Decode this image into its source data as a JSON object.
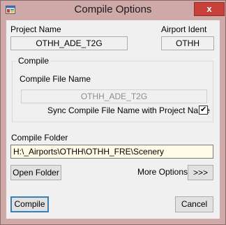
{
  "window": {
    "title": "Compile Options",
    "close_label": "x"
  },
  "project": {
    "name_label": "Project Name",
    "name_value": "OTHH_ADE_T2G",
    "ident_label": "Airport Ident",
    "ident_value": "OTHH"
  },
  "compile_group": {
    "title": "Compile",
    "file_name_label": "Compile File Name",
    "file_name_value": "OTHH_ADE_T2G",
    "sync_label": "Sync Compile File Name with Project Name",
    "sync_checked": true,
    "checkmark": "✔"
  },
  "folder": {
    "label": "Compile Folder",
    "value": "H:\\_Airports\\OTHH\\OTHH_FRE\\Scenery",
    "open_button": "Open Folder",
    "more_label": "More Options",
    "more_button": ">>>"
  },
  "actions": {
    "compile": "Compile",
    "cancel": "Cancel"
  }
}
